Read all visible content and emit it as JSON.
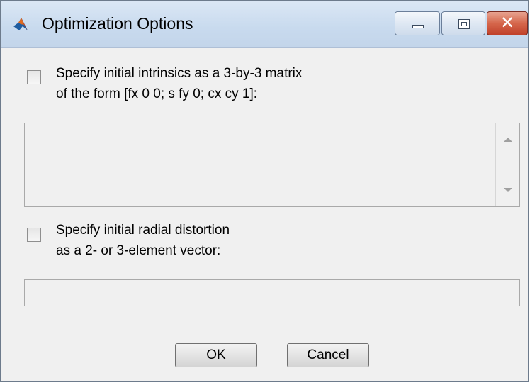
{
  "window": {
    "title": "Optimization Options",
    "icon": "matlab-icon",
    "controls": {
      "minimize": "minimize-icon",
      "maximize": "maximize-icon",
      "close": "close-icon",
      "close_glyph": "✕"
    }
  },
  "intrinsics": {
    "checked": false,
    "label_line1": "Specify initial intrinsics as a 3-by-3 matrix",
    "label_line2": "of the form [fx 0 0; s fy 0; cx cy 1]:",
    "value": ""
  },
  "radial": {
    "checked": false,
    "label_line1": "Specify initial radial distortion",
    "label_line2": "as a 2- or 3-element vector:",
    "value": ""
  },
  "buttons": {
    "ok": "OK",
    "cancel": "Cancel"
  },
  "colors": {
    "titlebar": "#c8daee",
    "close_button": "#c0412a",
    "dialog_background": "#f0f0f0"
  }
}
